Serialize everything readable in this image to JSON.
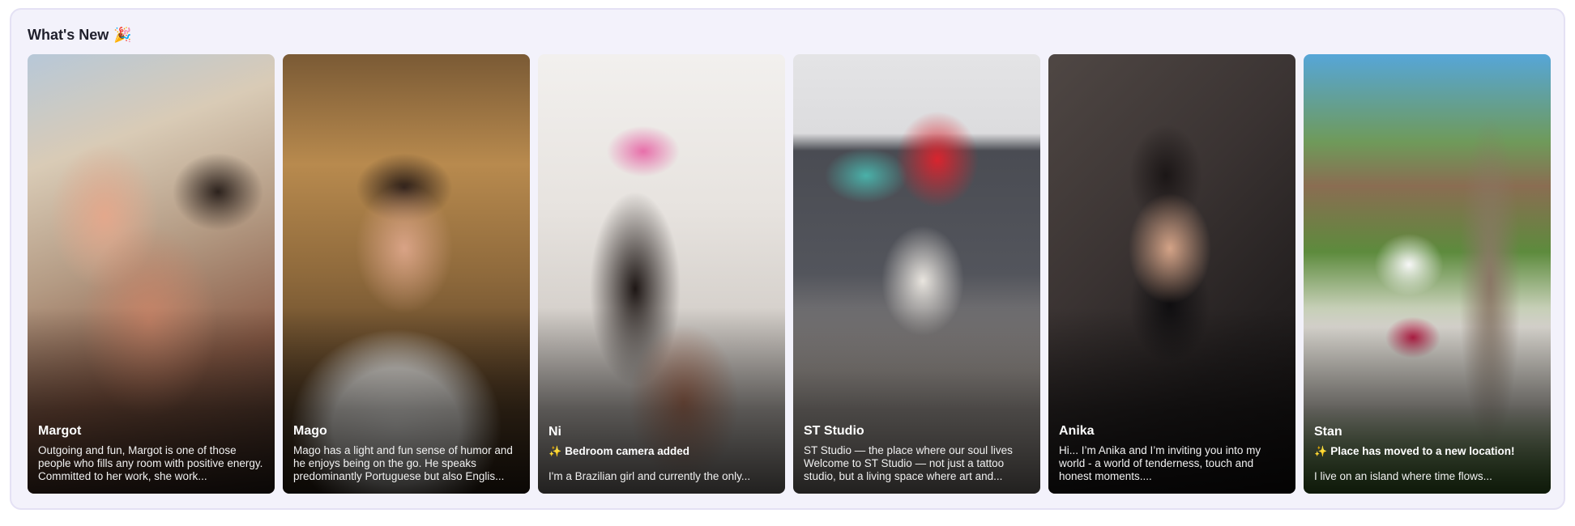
{
  "section": {
    "title": "What's New",
    "title_emoji": "🎉"
  },
  "cards": [
    {
      "name": "Margot",
      "update": "",
      "description": "Outgoing and fun, Margot is one of those people who fills any room with positive energy. Committed to her work, she work..."
    },
    {
      "name": "Mago",
      "update": "",
      "description": "Mago has a light and fun sense of humor and he enjoys being on the go. He speaks predominantly Portuguese but also Englis..."
    },
    {
      "name": "Ni",
      "update": "Bedroom camera added",
      "description": "I'm a Brazilian girl and currently the only..."
    },
    {
      "name": "ST Studio",
      "update": "",
      "description": "ST Studio — the place where our soul lives Welcome to ST Studio — not just a tattoo studio, but a living space where art and..."
    },
    {
      "name": "Anika",
      "update": "",
      "description": "Hi... I’m Anika and I’m inviting you into my world - a world of tenderness, touch and honest moments...."
    },
    {
      "name": "Stan",
      "update": "Place has moved to a new location!",
      "description": "I live on an island where time flows..."
    }
  ],
  "icons": {
    "update_icon": "sparkles-icon"
  },
  "colors": {
    "panel_bg": "#f3f2fb",
    "panel_border": "#e4e1f4",
    "sparkle": "#ffd84a"
  }
}
